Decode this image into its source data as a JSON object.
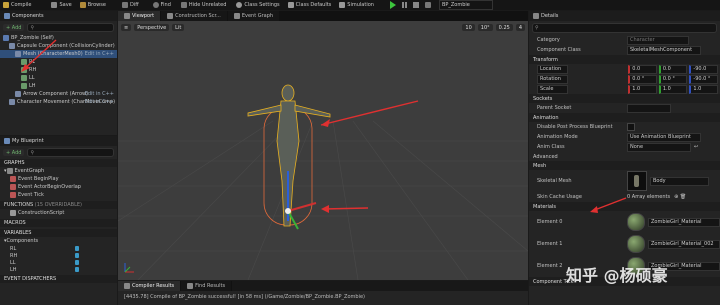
{
  "toolbar": {
    "items": [
      "Compile",
      "Save",
      "Browse",
      "Diff",
      "Find",
      "Hide Unrelated",
      "Class Settings",
      "Class Defaults",
      "Simulation"
    ],
    "blueprint_name": "BP_Zombie",
    "play_color": "#3cc43c"
  },
  "components": {
    "title": "Components",
    "add_label": "+ Add",
    "root": "BP_Zombie (Self)",
    "items": [
      {
        "label": "Capsule Component (CollisionCylinder)",
        "depth": 1
      },
      {
        "label": "Mesh (CharacterMesh0)",
        "depth": 2,
        "selected": true,
        "edit": "Edit in C++"
      },
      {
        "label": "RL",
        "depth": 3
      },
      {
        "label": "RH",
        "depth": 3
      },
      {
        "label": "LL",
        "depth": 3
      },
      {
        "label": "LH",
        "depth": 3
      },
      {
        "label": "Arrow Component (Arrow)",
        "depth": 2,
        "edit": "Edit in C++"
      },
      {
        "label": "Character Movement (CharMoveComp)",
        "depth": 1,
        "edit": "Edit in C++"
      }
    ]
  },
  "my_blueprint": {
    "title": "My Blueprint",
    "add_label": "+ Add",
    "graphs_label": "GRAPHS",
    "event_graph": "EventGraph",
    "events": [
      "Event BeginPlay",
      "Event ActorBeginOverlap",
      "Event Tick"
    ],
    "functions_label": "FUNCTIONS",
    "functions_suffix": "(15 OVERRIDABLE)",
    "construction": "ConstructionScript",
    "macros_label": "MACROS",
    "variables_label": "VARIABLES",
    "components_label": "Components",
    "component_vars": [
      "RL",
      "RH",
      "LL",
      "LH"
    ],
    "dispatchers_label": "EVENT DISPATCHERS"
  },
  "tabs": [
    "Viewport",
    "Construction Scr...",
    "Event Graph"
  ],
  "viewport": {
    "perspective": "Perspective",
    "lit": "Lit",
    "stats": [
      "10",
      "10°",
      "0.25",
      "4"
    ]
  },
  "bottom": {
    "tabs": [
      "Compiler Results",
      "Find Results"
    ],
    "log": "[4435.78] Compile of BP_Zombie successful! [in 58 ms] (/Game/Zombie/BP_Zombie.BP_Zombie)"
  },
  "details": {
    "title": "Details",
    "category_label": "Category",
    "category_value": "Character",
    "component_class_label": "Component Class",
    "component_class_value": "SkeletalMeshComponent",
    "transform_label": "Transform",
    "transform_rows": [
      {
        "label": "Location",
        "values": [
          "0.0",
          "0.0",
          "-90.0"
        ]
      },
      {
        "label": "Rotation",
        "values": [
          "0.0 °",
          "0.0 °",
          "-90.0 °"
        ]
      },
      {
        "label": "Scale",
        "values": [
          "1.0",
          "1.0",
          "1.0"
        ]
      }
    ],
    "sockets_label": "Sockets",
    "parent_socket_label": "Parent Socket",
    "animation_label": "Animation",
    "disable_pp_label": "Disable Post Process Blueprint",
    "anim_mode_label": "Animation Mode",
    "anim_mode_value": "Use Animation Blueprint",
    "anim_class_label": "Anim Class",
    "anim_class_value": "None",
    "advanced_label": "Advanced",
    "mesh_label": "Mesh",
    "skeletal_mesh_label": "Skeletal Mesh",
    "skeletal_mesh_value": "Body",
    "skin_cache_label": "Skin Cache Usage",
    "skin_cache_value": "0 Array elements",
    "materials_label": "Materials",
    "materials": [
      {
        "label": "Element 0",
        "value": "ZombieGirl_Material"
      },
      {
        "label": "Element 1",
        "value": "ZombieGirl_Material_002"
      },
      {
        "label": "Element 2",
        "value": "ZombieGirl_Material"
      }
    ],
    "component_tick_label": "Component Tick"
  },
  "watermark": "知乎 @杨硕豪"
}
